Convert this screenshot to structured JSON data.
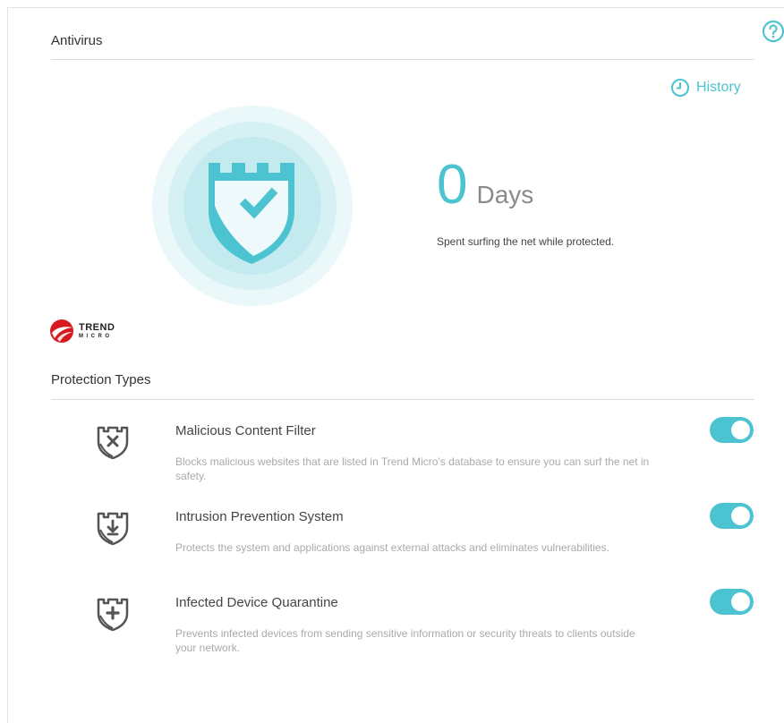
{
  "header": {
    "title": "Antivirus",
    "history_label": "History"
  },
  "summary": {
    "days_value": "0",
    "days_unit": "Days",
    "description": "Spent surfing the net while protected."
  },
  "brand": {
    "line1": "TREND",
    "line2": "MICRO"
  },
  "protection": {
    "title": "Protection Types",
    "items": [
      {
        "name": "Malicious Content Filter",
        "description": "Blocks malicious websites that are listed in Trend Micro's database to ensure you can surf the net in safety.",
        "enabled": true,
        "icon": "shield-x-icon"
      },
      {
        "name": "Intrusion Prevention System",
        "description": "Protects the system and applications against external attacks and eliminates vulnerabilities.",
        "enabled": true,
        "icon": "shield-arrow-icon"
      },
      {
        "name": "Infected Device Quarantine",
        "description": "Prevents infected devices from sending sensitive information or security threats to clients outside your network.",
        "enabled": true,
        "icon": "shield-plus-icon"
      }
    ]
  },
  "colors": {
    "accent": "#4cc3d0",
    "halo_outer": "#eaf8fa",
    "halo_mid": "#d6f1f4",
    "halo_inner": "#c3eaef"
  }
}
